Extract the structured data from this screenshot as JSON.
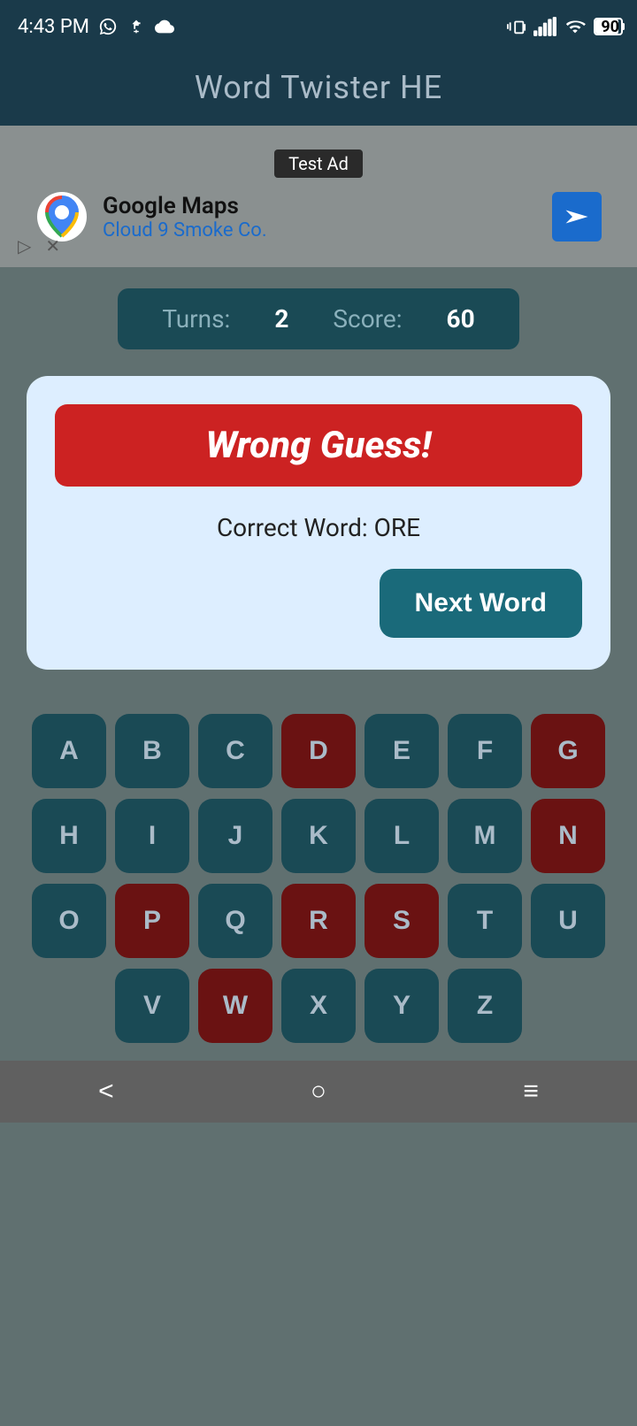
{
  "statusBar": {
    "time": "4:43 PM",
    "icons": [
      "whatsapp",
      "usb",
      "cloud",
      "vibrate",
      "signal",
      "wifi",
      "battery"
    ],
    "batteryLevel": "90"
  },
  "appTitle": "Word Twister HE",
  "ad": {
    "label": "Test Ad",
    "logoAlt": "Google Maps logo",
    "title": "Google Maps",
    "subtitle": "Cloud 9 Smoke Co.",
    "navIconAlt": "navigation arrow"
  },
  "scoreBar": {
    "turnsLabel": "Turns:",
    "turnsValue": "2",
    "scoreLabel": "Score:",
    "scoreValue": "60"
  },
  "dialog": {
    "wrongGuessText": "Wrong Guess!",
    "correctWordLabel": "Correct Word:",
    "correctWord": "ORE",
    "nextWordBtn": "Next Word"
  },
  "keyboard": {
    "rows": [
      [
        {
          "letter": "A",
          "used": false
        },
        {
          "letter": "B",
          "used": false
        },
        {
          "letter": "C",
          "used": false
        },
        {
          "letter": "D",
          "used": true
        },
        {
          "letter": "E",
          "used": false
        },
        {
          "letter": "F",
          "used": false
        },
        {
          "letter": "G",
          "used": true
        }
      ],
      [
        {
          "letter": "H",
          "used": false
        },
        {
          "letter": "I",
          "used": false
        },
        {
          "letter": "J",
          "used": false
        },
        {
          "letter": "K",
          "used": false
        },
        {
          "letter": "L",
          "used": false
        },
        {
          "letter": "M",
          "used": false
        },
        {
          "letter": "N",
          "used": true
        }
      ],
      [
        {
          "letter": "O",
          "used": false
        },
        {
          "letter": "P",
          "used": true
        },
        {
          "letter": "Q",
          "used": false
        },
        {
          "letter": "R",
          "used": true
        },
        {
          "letter": "S",
          "used": true
        },
        {
          "letter": "T",
          "used": false
        },
        {
          "letter": "U",
          "used": false
        }
      ],
      [
        {
          "letter": "V",
          "used": false
        },
        {
          "letter": "W",
          "used": true
        },
        {
          "letter": "X",
          "used": false
        },
        {
          "letter": "Y",
          "used": false
        },
        {
          "letter": "Z",
          "used": false
        }
      ]
    ]
  },
  "navBar": {
    "backLabel": "<",
    "homeLabel": "○",
    "menuLabel": "≡"
  }
}
